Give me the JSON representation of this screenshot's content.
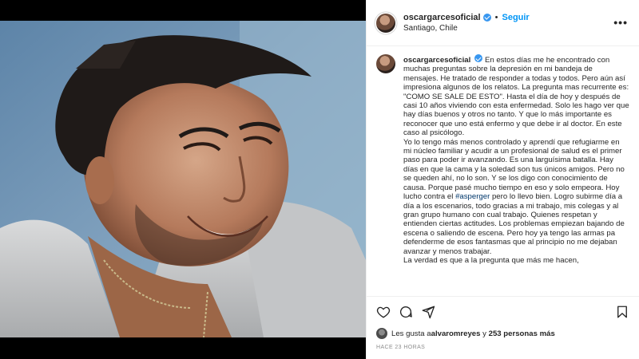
{
  "post": {
    "username": "oscargarcesoficial",
    "follow_label": "Seguir",
    "separator": "•",
    "location": "Santiago, Chile",
    "more_label": "•••",
    "caption_lines": [
      "En estos días me he encontrado con muchas preguntas sobre la depresión en mi bandeja de mensajes. He tratado de responder a todas y todos. Pero aún así impresiona algunos de los relatos. La pregunta mas recurrente es:",
      "\"COMO SE SALE DE ESTO\". Hasta el día de hoy y después de casi 10 años viviendo con esta enfermedad. Solo les hago ver que hay días buenos y otros no tanto. Y que lo más importante es reconocer que uno está enfermo y que debe ir al doctor. En este caso al psicólogo.",
      "Yo lo tengo más menos controlado y aprendí que refugiarme en mi núcleo familiar y acudir a un profesional de salud es el primer paso para poder ir avanzando. Es una larguísima batalla. Hay días en que la cama y la soledad son tus únicos amigos. Pero no se queden ahí, no lo son. Y se los digo con conocimiento de causa. Porque pasé mucho tiempo en eso y solo empeora. Hoy lucho contra el"
    ],
    "hashtag": "#asperger",
    "caption_after_hashtag": " pero lo llevo bien. Logro subirme día a día a los escenarios, todo gracias a mi trabajo, mis colegas y al gran grupo humano con cual trabajo. Quienes respetan y entienden ciertas actitudes. Los problemas empiezan bajando de escena o saliendo de escena. Pero hoy ya tengo las armas pa defenderme de esos fantasmas que al principio no me dejaban avanzar y menos trabajar.",
    "caption_last": "La verdad es que a la pregunta que más me hacen,",
    "likes_prefix": "Les gusta a ",
    "likes_user": "alvaromreyes",
    "likes_middle": " y ",
    "likes_count": "253 personas más",
    "timestamp": "HACE 23 HORAS"
  },
  "icons": [
    "heart-icon",
    "comment-icon",
    "share-icon",
    "bookmark-icon",
    "verified-badge-icon",
    "more-options-icon"
  ],
  "colors": {
    "follow": "#0095f6",
    "verified": "#3897f0",
    "hashtag": "#00376b",
    "muted": "#8e8e8e"
  }
}
